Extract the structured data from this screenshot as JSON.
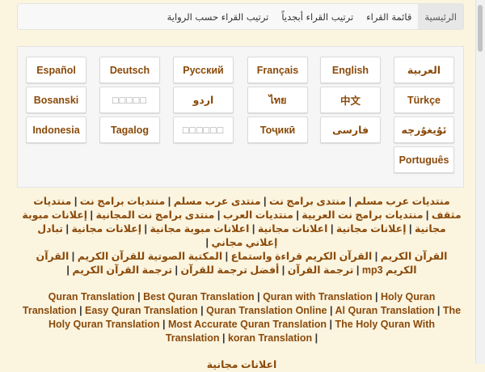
{
  "nav": {
    "items": [
      {
        "label": "الرئيسية",
        "active": true
      },
      {
        "label": "قائمة القراء",
        "active": false
      },
      {
        "label": "ترتيب القراء أبجدياً",
        "active": false
      },
      {
        "label": "ترتيب القراء حسب الرواية",
        "active": false
      }
    ]
  },
  "languages": {
    "row1": [
      "العربية",
      "English",
      "Français",
      "Русский",
      "Deutsch",
      "Español"
    ],
    "row2": [
      "Türkçe",
      "中文",
      "ไทย",
      "اردو",
      "□□□□□",
      "Bosanski"
    ],
    "row3": [
      "ئۇيغۇرچە",
      "فارسی",
      "Тоҷикӣ",
      "□□□□□□",
      "Tagalog",
      "Indonesia"
    ],
    "row4": [
      "Português"
    ]
  },
  "links_block1": [
    "منتديات عرب مسلم",
    "منتدى برامج نت",
    "منتدى عرب مسلم",
    "منتديات برامج نت",
    "منتديات مثقف",
    "منتديات برامج نت العربية",
    "منتديات العرب",
    "منتدى برامج نت المجانية",
    "إعلانات مبوبة مجانية",
    "إعلانات مجانية",
    "اعلانات مجانية",
    "اعلانات مبوبة مجانية",
    "إعلانات مجانية",
    "تبادل إعلاني مجاني"
  ],
  "links_block2": [
    "القرآن الكريم",
    "القرآن الكريم قراءة واستماع",
    "المكتبة الصوتية للقرآن الكريم",
    "القرآن الكريم mp3",
    "ترجمة القرآن",
    "أفضل ترجمة للقرآن",
    "ترجمة القرآن الكريم"
  ],
  "links_block3": [
    "Quran Translation",
    "Best Quran Translation",
    "Quran with Translation",
    "Holy Quran Translation",
    "Easy Quran Translation",
    "Quran Translation Online",
    "Al Quran Translation",
    "The Holy Quran Translation",
    "Most Accurate Quran Translation",
    "The Holy Quran With Translation",
    "koran Translation"
  ],
  "links_block4_partial": "اعلانات مجانية"
}
